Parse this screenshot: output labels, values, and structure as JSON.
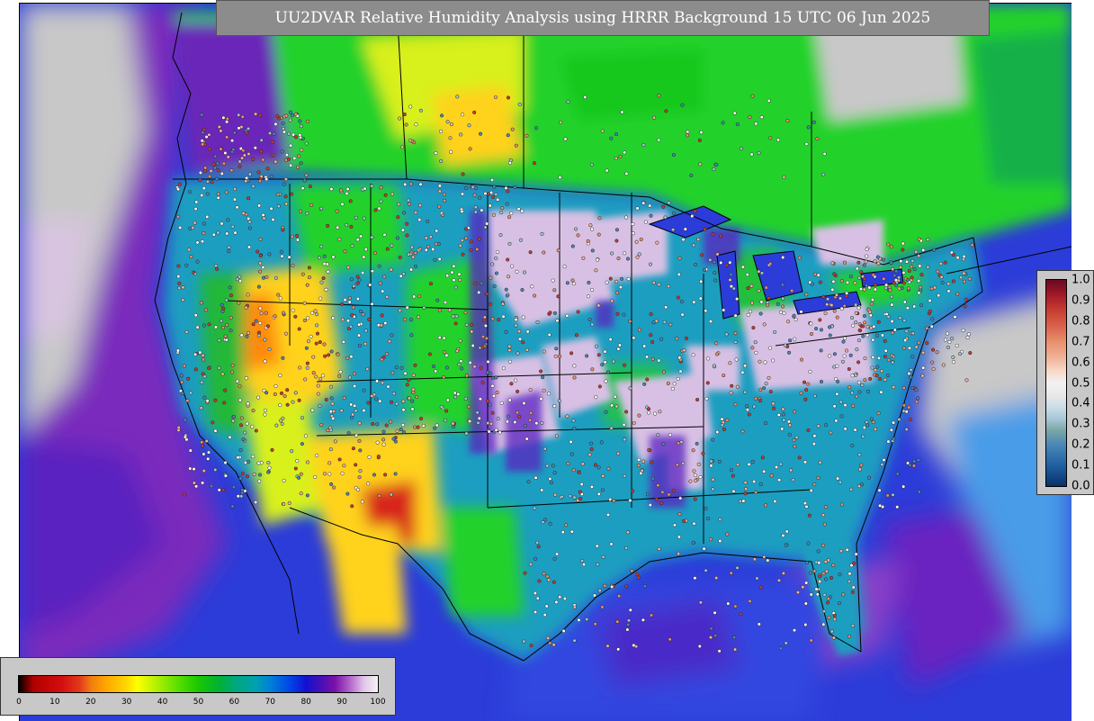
{
  "title": "UU2DVAR Relative Humidity Analysis using HRRR Background 15 UTC 06 Jun 2025",
  "colorbar_rh": {
    "ticks": [
      "0",
      "10",
      "20",
      "30",
      "40",
      "50",
      "60",
      "70",
      "80",
      "90",
      "100"
    ],
    "min": 0,
    "max": 100
  },
  "colorbar_residual": {
    "ticks": [
      "1.0",
      "0.9",
      "0.8",
      "0.7",
      "0.6",
      "0.5",
      "0.4",
      "0.3",
      "0.2",
      "0.1",
      "0.0"
    ],
    "min": 0.0,
    "max": 1.0
  },
  "map": {
    "ocean_color": "#2c3cd8",
    "land_color": "#1e9ec0",
    "nodata_color": "#c8c8c8"
  },
  "regions": [
    {
      "label": "canada-green",
      "fill": "#22d22a"
    },
    {
      "label": "prairie-yellow",
      "fill": "#d8f01a"
    },
    {
      "label": "great-basin-yellow",
      "fill": "#ffd21c"
    },
    {
      "label": "southwest-dry-red",
      "fill": "#d8281a"
    },
    {
      "label": "central-plains-humid",
      "fill": "#d8c0e4"
    },
    {
      "label": "midwest-humid",
      "fill": "#d8c0e4"
    },
    {
      "label": "pacific-purple",
      "fill": "#6a28b8"
    }
  ]
}
